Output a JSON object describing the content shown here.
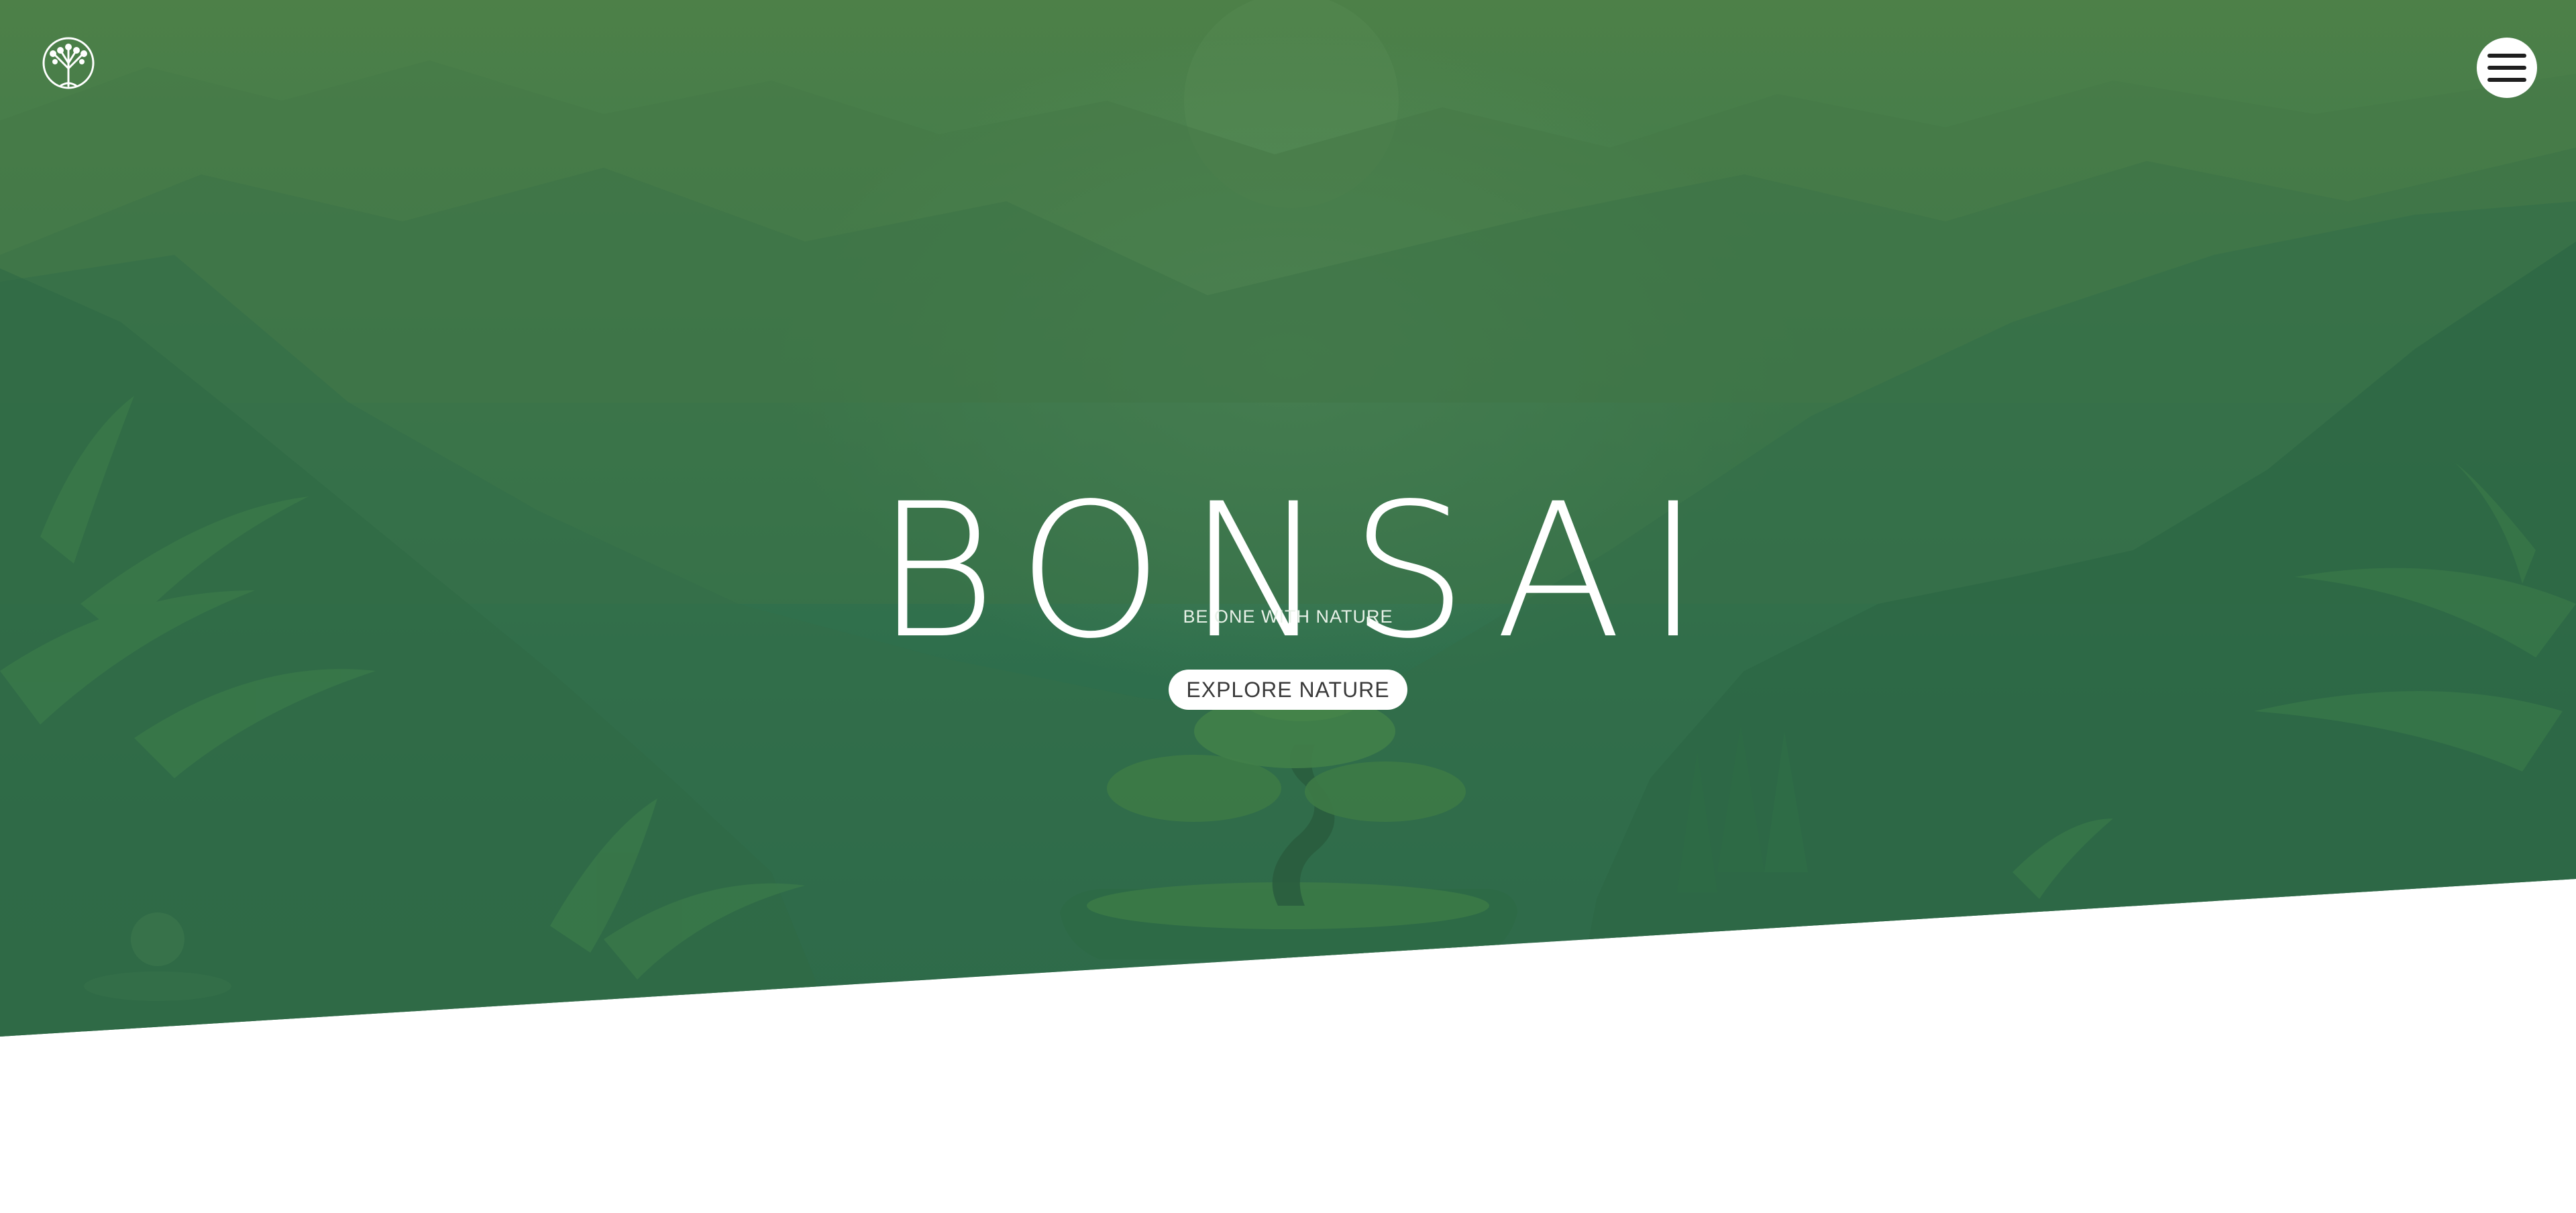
{
  "header": {
    "logo_icon": "tree-logo-icon",
    "menu_icon": "hamburger-menu-icon"
  },
  "hero": {
    "title": "BONSAI",
    "tagline": "BE ONE WITH NATURE",
    "cta_label": "EXPLORE NATURE"
  },
  "colors": {
    "hero_green_top": "#4d8048",
    "hero_green_bottom": "#26644a",
    "text": "#ffffff",
    "button_bg": "#ffffff",
    "button_text": "#3a3a3a",
    "page_bg": "#ffffff"
  }
}
